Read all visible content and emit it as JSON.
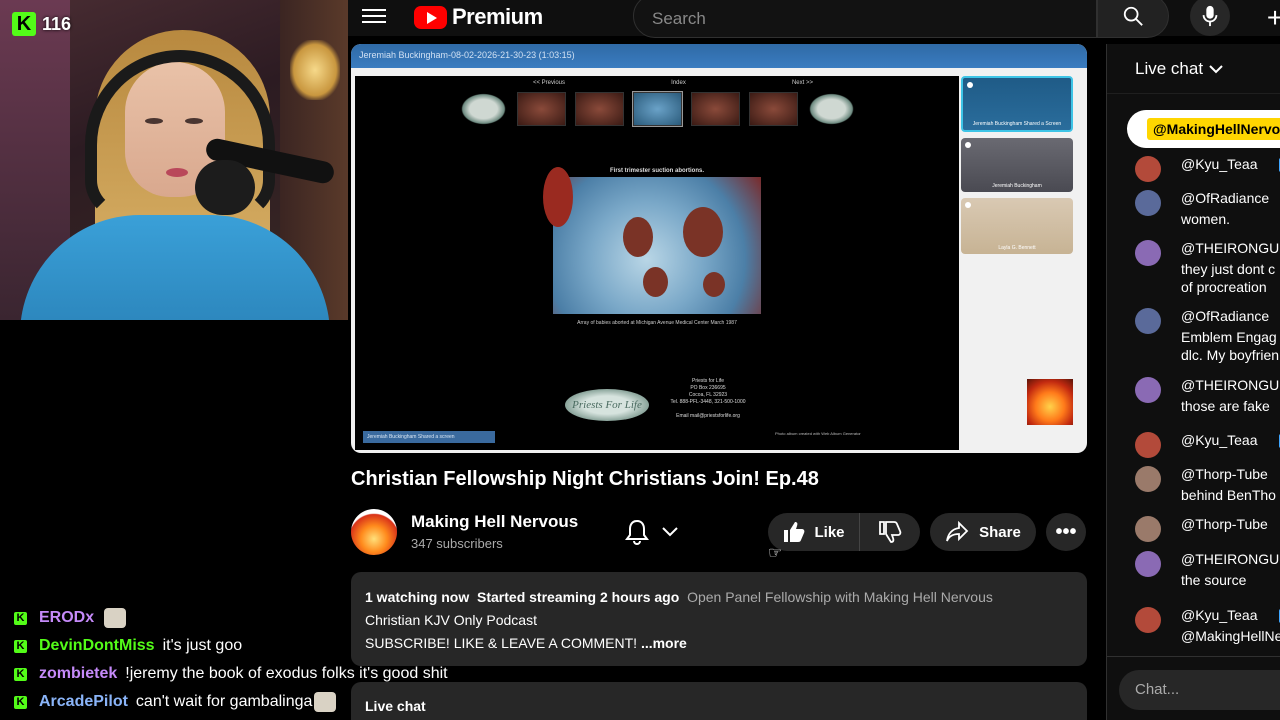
{
  "overlay": {
    "viewer_count": "116",
    "platform_icon": "K",
    "stream_chat": [
      {
        "user": "ERODx",
        "user_color": "#c58af9",
        "text": "",
        "emote": true
      },
      {
        "user": "DevinDontMiss",
        "user_color": "#53fc18",
        "text": "it's just goo",
        "emote": false
      },
      {
        "user": "zombietek",
        "user_color": "#c58af9",
        "text": "!jeremy the book of exodus folks it's good shit",
        "emote": false
      },
      {
        "user": "ArcadePilot",
        "user_color": "#8ab4f8",
        "text": "can't wait for gambalinga",
        "emote": true
      }
    ]
  },
  "header": {
    "logo_word": "Premium",
    "search_placeholder": "Search"
  },
  "player": {
    "meeting_bar": "Jeremiah Buckingham-08-02-2026-21-30-23  (1:03:15)",
    "nav": {
      "prev": "<< Previous",
      "index": "Index",
      "next": "Next >>"
    },
    "photo_title": "First trimester suction abortions.",
    "photo_caption": "Array of babies aborted at Michigan Avenue Medical Center March 1987",
    "logo_text": "Priests For Life",
    "address_lines": [
      "Priests for Life",
      "PO Box 236695",
      "Cocoa, FL 32923",
      "Tel. 888-PFL-3448, 321-500-1000",
      "",
      "Email mail@priestsforlife.org"
    ],
    "presenter_tag": "Jeremiah Buckingham Shared a screen",
    "photo_credit": "Photo album created with Web Album Generator",
    "participants": [
      {
        "name": "Jeremiah Buckingham Shared a Screen"
      },
      {
        "name": "Jeremiah Buckingham"
      },
      {
        "name": "Layla G. Bennett"
      }
    ]
  },
  "video": {
    "title": "Christian Fellowship Night Christians Join! Ep.48",
    "channel_name": "Making Hell Nervous",
    "subscribers": "347 subscribers",
    "like_label": "Like",
    "share_label": "Share"
  },
  "description": {
    "watching": "1 watching now",
    "started": "Started streaming 2 hours ago",
    "link_text": "Open Panel Fellowship with Making Hell Nervous",
    "line2": "Christian KJV Only Podcast",
    "line3": "SUBSCRIBE! LIKE & LEAVE A COMMENT!",
    "more_label": "...more"
  },
  "live_chat_toggle": "Live chat",
  "chat": {
    "header": "Live chat",
    "pinned_mention": "@MakingHellNervous",
    "messages": [
      {
        "user": "@Kyu_Teaa",
        "text": [],
        "avatar_color": "#b34a3a",
        "badge": true
      },
      {
        "user": "@OfRadiance",
        "text": [
          "women."
        ],
        "avatar_color": "#5a6a9a",
        "badge": false
      },
      {
        "user": "@THEIRONGUILD",
        "text": [
          "they just dont c",
          "of procreation"
        ],
        "avatar_color": "#8a6ab4",
        "badge": false
      },
      {
        "user": "@OfRadiance",
        "text": [
          "Emblem Engag",
          "dlc. My boyfrien"
        ],
        "avatar_color": "#5a6a9a",
        "badge": false
      },
      {
        "user": "@THEIRONGUILD",
        "text": [
          "those are fake"
        ],
        "avatar_color": "#8a6ab4",
        "badge": false
      },
      {
        "user": "@Kyu_Teaa",
        "text": [],
        "avatar_color": "#b34a3a",
        "badge": true
      },
      {
        "user": "@Thorp-Tube",
        "text": [
          "behind BenTho"
        ],
        "avatar_color": "#9a7a6a",
        "badge": false
      },
      {
        "user": "@Thorp-Tube",
        "text": [],
        "avatar_color": "#9a7a6a",
        "badge": false
      },
      {
        "user": "@THEIRONGUILD",
        "text": [
          "the source"
        ],
        "avatar_color": "#8a6ab4",
        "badge": false
      },
      {
        "user": "@Kyu_Teaa",
        "text": [
          "@MakingHellNe"
        ],
        "avatar_color": "#b34a3a",
        "badge": true
      }
    ],
    "input_placeholder": "Chat..."
  }
}
